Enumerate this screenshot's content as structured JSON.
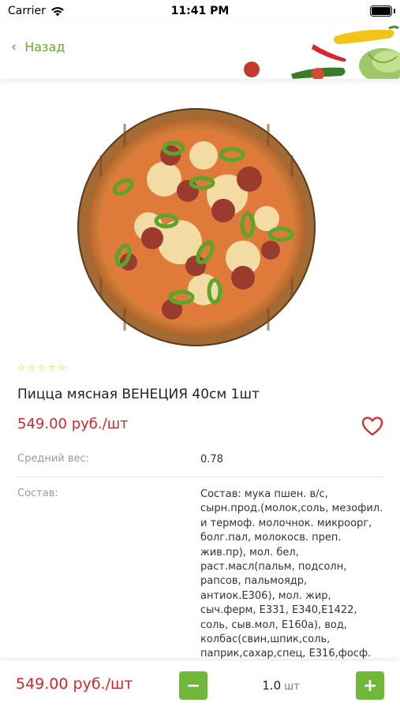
{
  "status_bar": {
    "carrier": "Carrier",
    "time": "11:41 PM"
  },
  "header": {
    "back_label": "Назад",
    "accent_color": "#6aa82c"
  },
  "product": {
    "rating_stars": 5,
    "rating_filled": 0,
    "title": "Пицца мясная ВЕНЕЦИЯ 40см 1шт",
    "price": "549.00 руб./шт",
    "favorite": false
  },
  "details": {
    "weight_label": "Средний вес:",
    "weight_value": "0.78",
    "composition_label": "Состав:",
    "composition_value": "Состав: мука пшен. в/с, сырн.прод.(молок,соль, мезофил. и термоф. молочнок. микроорг, болг.пал, молокосв. преп. жив.пр), мол. бел, раст.масл(пальм, подсолн, рапсов, пальмоядр, антиок.Е306), мол. жир, сыч.ферм, Е331, Е340,Е1422, соль, сыв.мол, Е160а), вод, колбас(свин,шпик,соль, паприк,сахар,спец, Е316,фосф."
  },
  "bottom_bar": {
    "price": "549.00 руб./шт",
    "quantity": "1.0",
    "unit": "шт",
    "minus_label": "−",
    "plus_label": "+",
    "button_color": "#6fb83a",
    "price_color": "#d8262b"
  }
}
